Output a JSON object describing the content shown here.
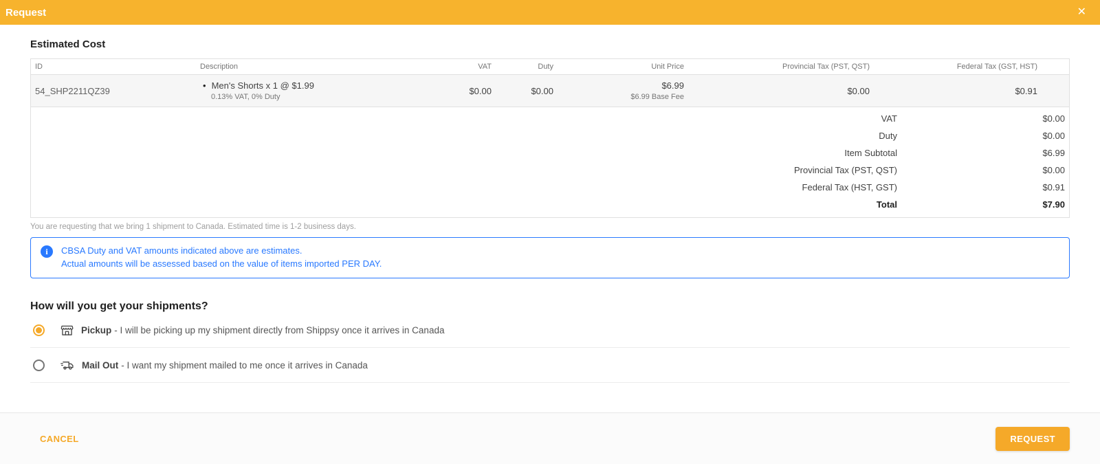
{
  "header": {
    "title": "Request",
    "close_icon": "✕",
    "bg_color": "#F7B32D"
  },
  "estimated_cost": {
    "heading": "Estimated Cost",
    "table": {
      "columns": {
        "id": "ID",
        "description": "Description",
        "vat": "VAT",
        "duty": "Duty",
        "unit_price": "Unit Price",
        "provincial_tax": "Provincial Tax (PST, QST)",
        "federal_tax": "Federal Tax (GST, HST)"
      },
      "row": {
        "id": "54_SHP2211QZ39",
        "bullet": "•",
        "description": "Men's Shorts x 1 @ $1.99",
        "description_sub": "0.13% VAT, 0% Duty",
        "vat": "$0.00",
        "duty": "$0.00",
        "unit_price": "$6.99",
        "unit_price_sub": "$6.99 Base Fee",
        "provincial_tax": "$0.00",
        "federal_tax": "$0.91"
      },
      "summary": [
        {
          "label": "VAT",
          "value": "$0.00"
        },
        {
          "label": "Duty",
          "value": "$0.00"
        },
        {
          "label": "Item Subtotal",
          "value": "$6.99"
        },
        {
          "label": "Provincial Tax (PST, QST)",
          "value": "$0.00"
        },
        {
          "label": "Federal Tax (HST, GST)",
          "value": "$0.91"
        },
        {
          "label": "Total",
          "value": "$7.90"
        }
      ]
    },
    "note": "You are requesting that we bring 1 shipment to Canada. Estimated time is 1-2 business days."
  },
  "info_box": {
    "line1": "CBSA Duty and VAT amounts indicated above are estimates.",
    "line2": "Actual amounts will be assessed based on the value of items imported PER DAY.",
    "accent_color": "#2979FF"
  },
  "shipment_options": {
    "heading": "How will you get your shipments?",
    "options": [
      {
        "label": "Pickup",
        "description": "- I will be picking up my shipment directly from Shippsy once it arrives in Canada",
        "selected": true
      },
      {
        "label": "Mail Out",
        "description": "- I want my shipment mailed to me once it arrives in Canada",
        "selected": false
      }
    ]
  },
  "footer": {
    "cancel_label": "CANCEL",
    "request_label": "REQUEST",
    "accent_color": "#F5A929"
  }
}
